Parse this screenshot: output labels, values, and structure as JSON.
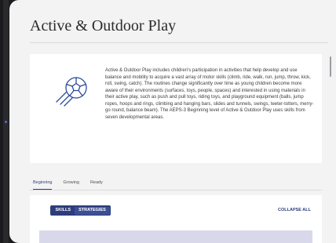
{
  "page": {
    "title": "Active & Outdoor Play"
  },
  "description": {
    "icon": "soccer-ball-motion-icon",
    "text": "Active & Outdoor Play includes children's participation in activities that help develop and use balance and mobility to acquire a vast array of motor skills (climb, ride, walk, run, jump, throw, kick, roll, swing, catch). The routines change significantly over time as young children become more aware of their environments (surfaces, toys, people, spaces) and interested in using materials in their active play, such as push and pull toys, riding toys, and playground equipment (balls, jump ropes, hoops and rings, climbing and hanging bars, slides and tunnels, swings, teeter-totters, merry-go round, balance beam). The AEPS-3 Beginning level of Active & Outdoor Play uses skills from seven developmental areas."
  },
  "tabs": [
    {
      "label": "Beginning",
      "active": true
    },
    {
      "label": "Growing",
      "active": false
    },
    {
      "label": "Ready",
      "active": false
    }
  ],
  "toggle": {
    "skills_label": "SKILLS",
    "strategies_label": "STRATEGIES",
    "selected": "STRATEGIES"
  },
  "collapse_all_label": "COLLAPSE ALL",
  "colors": {
    "accent": "#2d3d7c",
    "icon_blue": "#2b4a9a",
    "background": "#f3f3f4"
  }
}
